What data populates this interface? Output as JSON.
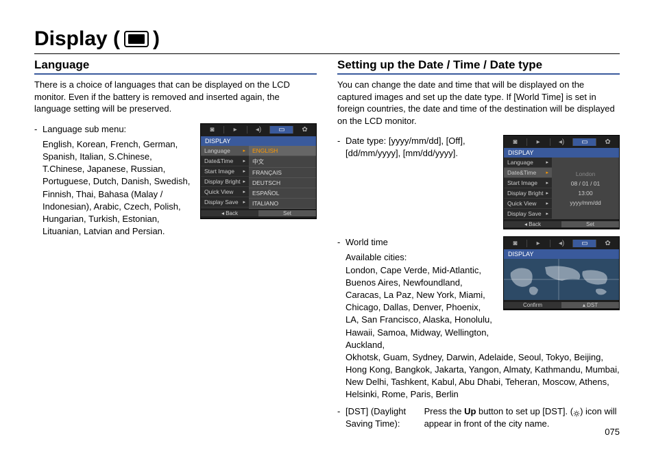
{
  "page": {
    "title_prefix": "Display (",
    "title_suffix": ")",
    "number": "075"
  },
  "lang_section": {
    "heading": "Language",
    "intro": "There is a choice of languages that can be displayed on the LCD monitor. Even if the battery is removed and inserted again, the language setting will be preserved.",
    "submenu_label": "Language sub menu:",
    "submenu_text": "English, Korean, French, German, Spanish, Italian, S.Chinese, T.Chinese, Japanese, Russian, Portuguese, Dutch, Danish, Swedish, Finnish, Thai, Bahasa (Malay / Indonesian), Arabic, Czech, Polish, Hungarian, Turkish, Estonian, Lituanian, Latvian and Persian."
  },
  "datetime_section": {
    "heading": "Setting up the Date / Time / Date type",
    "intro": "You can change the date and time that will be displayed on the captured images and set up the date type. If [World Time] is set in foreign countries, the date and time of the destination will be displayed on the LCD monitor.",
    "datetype_label": "Date type:",
    "datetype_values": "[yyyy/mm/dd], [Off], [dd/mm/yyyy], [mm/dd/yyyy].",
    "worldtime_label": "World time",
    "available_label": "Available cities:",
    "cities_short": "London, Cape Verde, Mid-Atlantic, Buenos Aires, Newfoundland, Caracas, La Paz, New York, Miami, Chicago, Dallas, Denver, Phoenix, LA, San Francisco, Alaska, Honolulu, Hawaii, Samoa, Midway, Wellington, Auckland,",
    "cities_full": "Okhotsk, Guam, Sydney, Darwin, Adelaide, Seoul, Tokyo, Beijing, Hong Kong, Bangkok, Jakarta, Yangon, Almaty, Kathmandu, Mumbai, New Delhi, Tashkent, Kabul, Abu Dhabi, Teheran, Moscow, Athens, Helsinki, Rome, Paris, Berlin",
    "dst_label": "[DST] (Daylight Saving Time):",
    "dst_text_1": "Press the ",
    "dst_up": "Up",
    "dst_text_2": " button to set up [DST]. (",
    "dst_text_3": ") icon will appear in front of the city name."
  },
  "cam1": {
    "header": "DISPLAY",
    "menu": [
      "Language",
      "Date&Time",
      "Start Image",
      "Display Bright",
      "Quick View",
      "Display Save"
    ],
    "values": [
      "ENGLISH",
      "中文",
      "FRANÇAIS",
      "DEUTSCH",
      "ESPAÑOL",
      "ITALIANO"
    ],
    "back": "Back",
    "set": "Set"
  },
  "cam2": {
    "header": "DISPLAY",
    "menu": [
      "Language",
      "Date&Time",
      "Start Image",
      "Display Bright",
      "Quick View",
      "Display Save"
    ],
    "city": "London",
    "date": "08 / 01 / 01",
    "time": "13:00",
    "format": "yyyy/mm/dd",
    "back": "Back",
    "set": "Set"
  },
  "cam3": {
    "header": "DISPLAY",
    "confirm": "Confirm",
    "dst": "DST"
  }
}
